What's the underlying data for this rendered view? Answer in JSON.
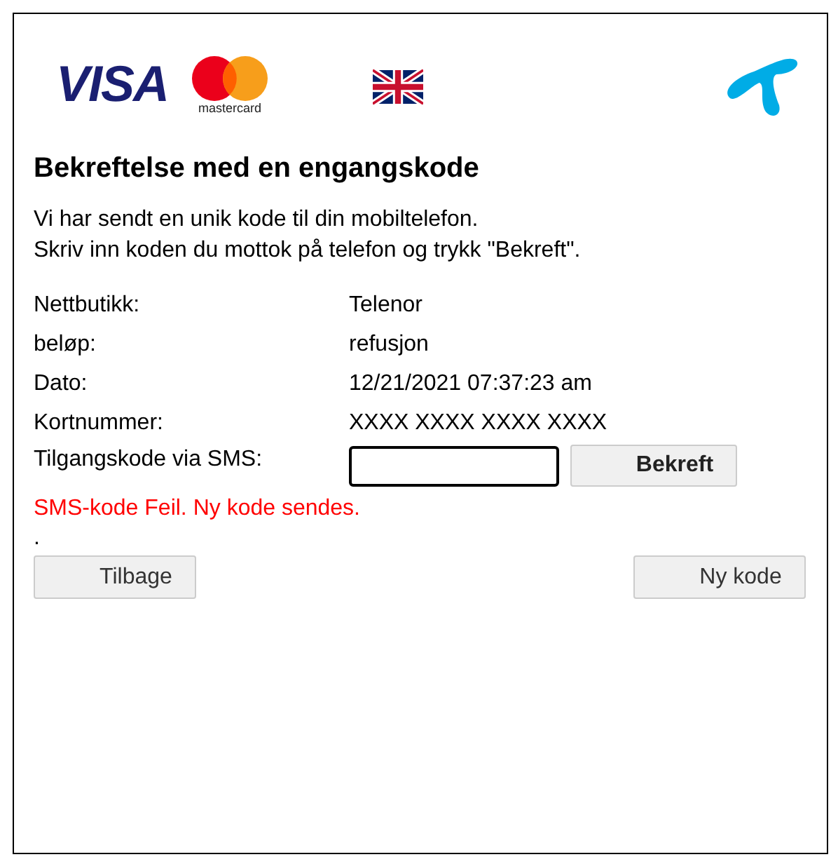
{
  "logos": {
    "visa": "VISA",
    "mastercard": "mastercard"
  },
  "title": "Bekreftelse med en engangskode",
  "intro": [
    "Vi har sendt en unik kode til din mobiltelefon.",
    "Skriv inn koden du mottok på telefon og trykk \"Bekreft\"."
  ],
  "details": [
    {
      "label": "Nettbutikk:",
      "value": "Telenor"
    },
    {
      "label": "beløp:",
      "value": "refusjon"
    },
    {
      "label": "Dato:",
      "value": "12/21/2021 07:37:23 am"
    },
    {
      "label": "Kortnummer:",
      "value": "XXXX XXXX XXXX XXXX"
    }
  ],
  "code_field": {
    "label": "Tilgangskode via SMS:",
    "focused": true
  },
  "confirm_button": "Bekreft",
  "error": "SMS-kode Feil. Ny kode sendes.",
  "note": ".",
  "buttons": {
    "back": "Tilbage",
    "new_code": "Ny kode"
  }
}
